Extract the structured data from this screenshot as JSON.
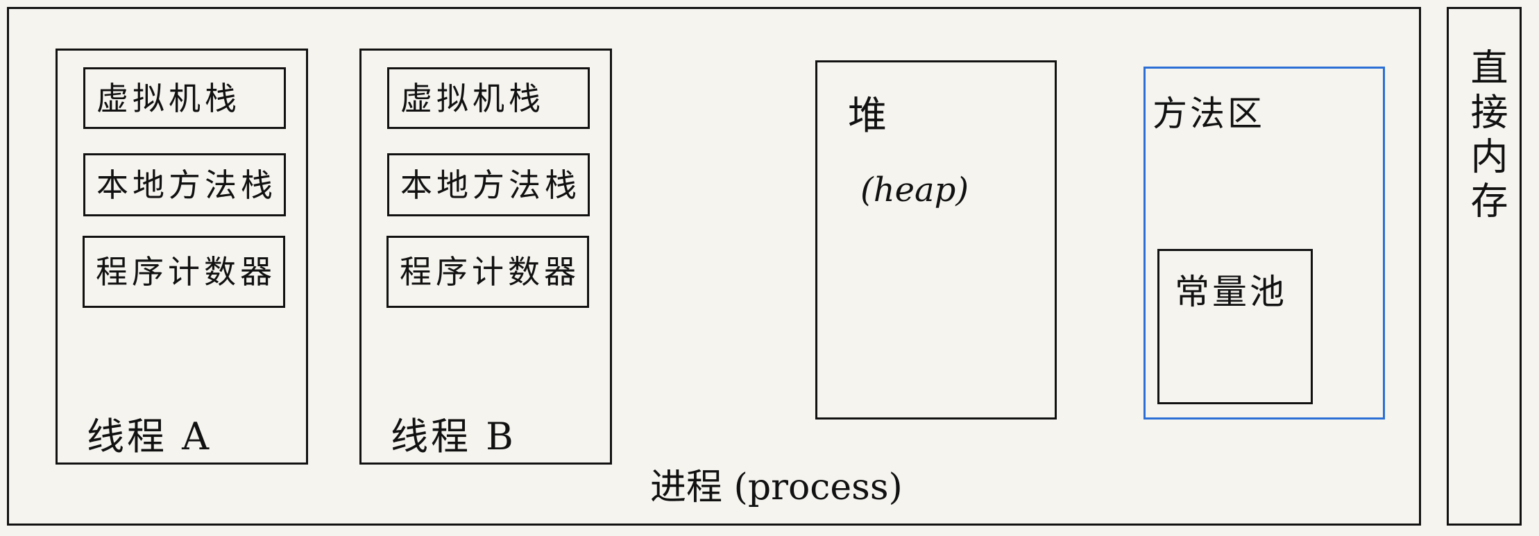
{
  "process": {
    "label": "进程 (process)"
  },
  "threads": [
    {
      "label": "线程 A",
      "items": [
        "虚拟机栈",
        "本地方法栈",
        "程序计数器"
      ]
    },
    {
      "label": "线程 B",
      "items": [
        "虚拟机栈",
        "本地方法栈",
        "程序计数器"
      ]
    }
  ],
  "heap": {
    "label": "堆",
    "sublabel": "(heap)"
  },
  "method_area": {
    "label": "方法区",
    "constant_pool": "常量池",
    "border_color": "#2b6fd6"
  },
  "direct_memory": {
    "label": "直接内存"
  }
}
